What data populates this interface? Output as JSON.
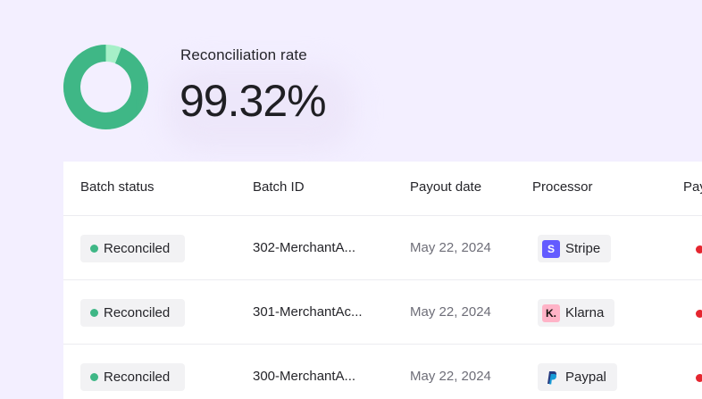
{
  "kpi": {
    "label": "Reconciliation rate",
    "value": "99.32%",
    "rate_fraction": 0.9932,
    "colors": {
      "main": "#3fb786",
      "remainder": "#a6f0c8"
    }
  },
  "table": {
    "columns": [
      "Batch status",
      "Batch ID",
      "Payout date",
      "Processor",
      "Pay"
    ],
    "rows": [
      {
        "status": "Reconciled",
        "batch_id": "302-MerchantA...",
        "payout_date": "May 22, 2024",
        "processor": "Stripe",
        "logo_icon": "stripe-logo-icon",
        "logo_text": "S"
      },
      {
        "status": "Reconciled",
        "batch_id": "301-MerchantAc...",
        "payout_date": "May 22, 2024",
        "processor": "Klarna",
        "logo_icon": "klarna-logo-icon",
        "logo_text": "K."
      },
      {
        "status": "Reconciled",
        "batch_id": "300-MerchantA...",
        "payout_date": "May 22, 2024",
        "processor": "Paypal",
        "logo_icon": "paypal-logo-icon",
        "logo_text": ""
      }
    ]
  }
}
